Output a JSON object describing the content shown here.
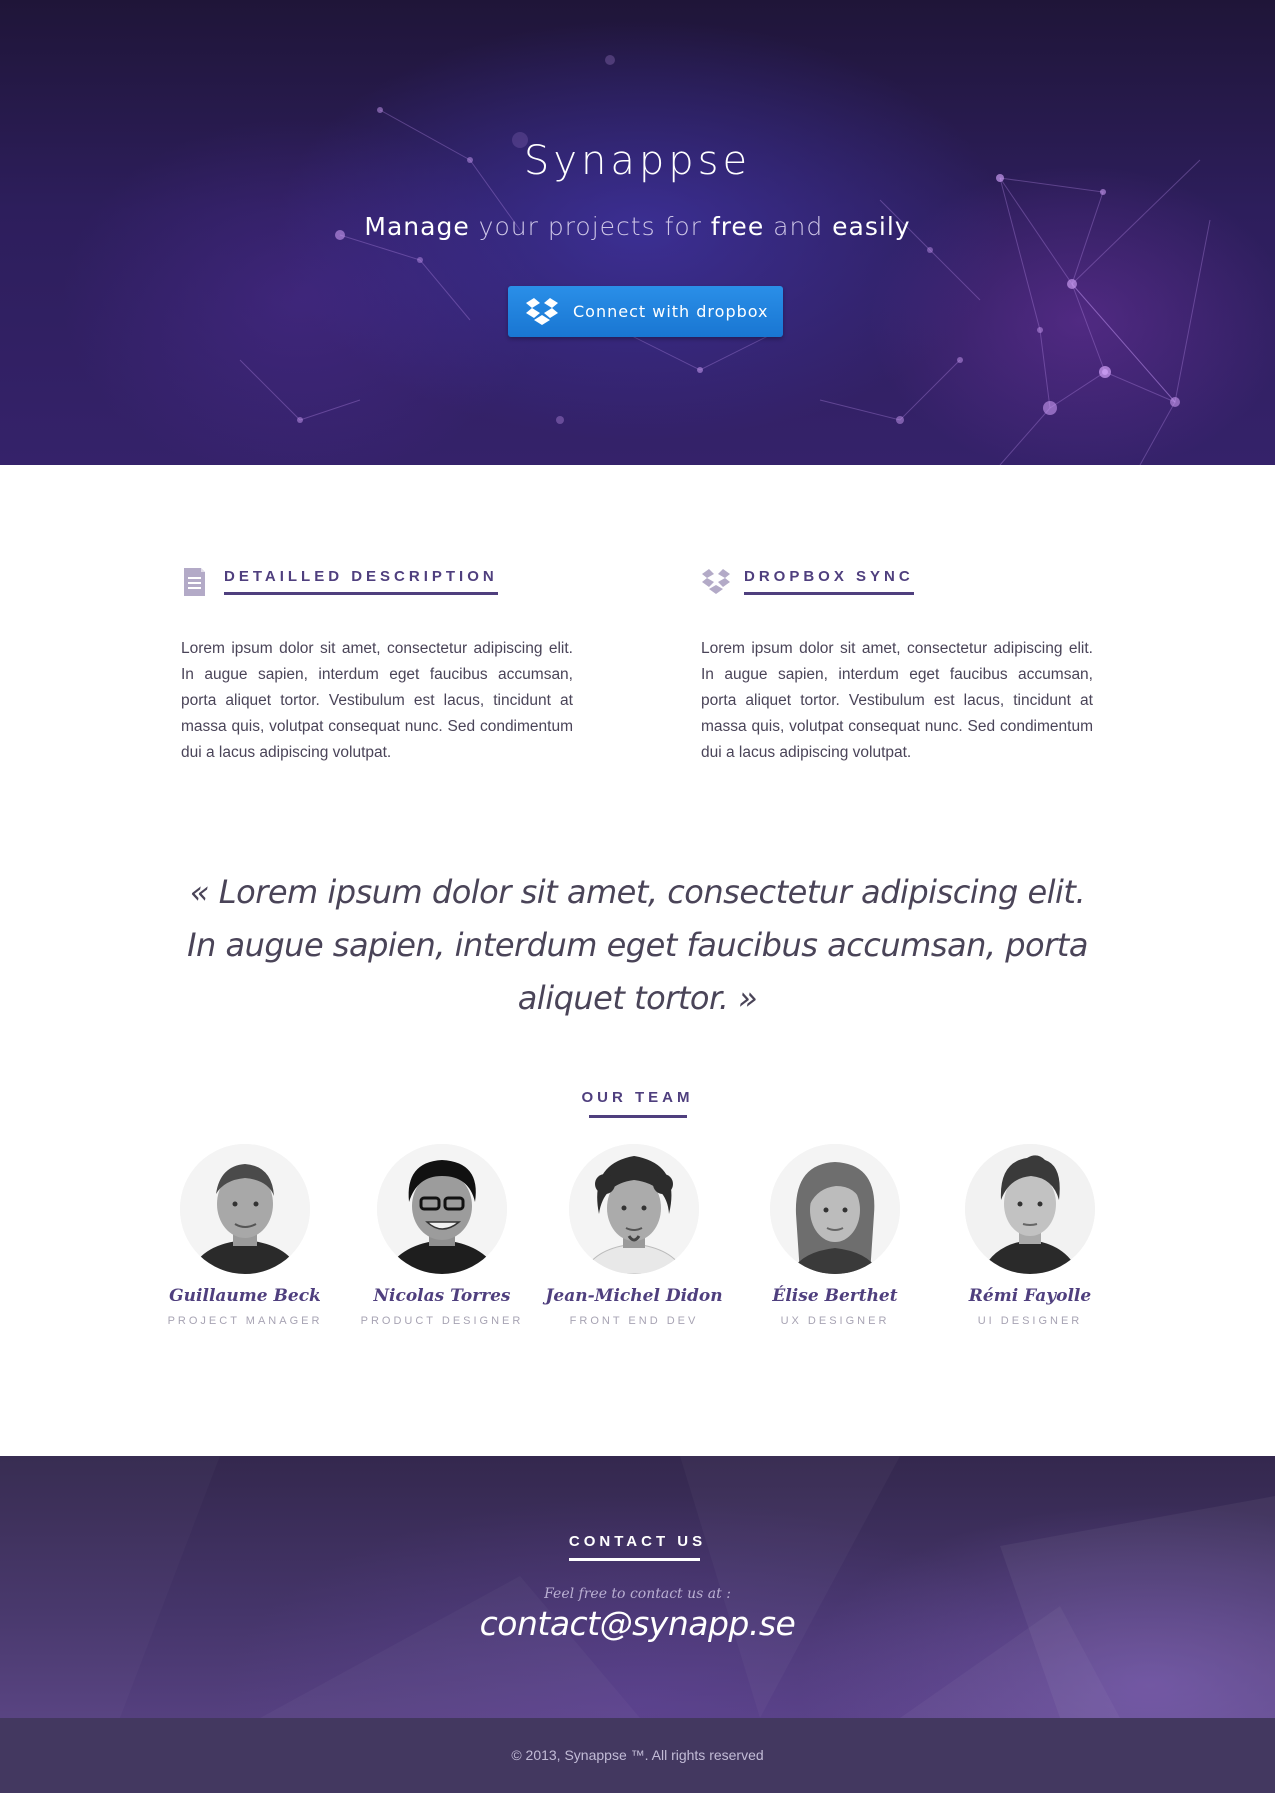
{
  "colors": {
    "brand_purple": "#4f3f7e",
    "dropbox_blue": "#1f86e0",
    "hero_dark": "#2d1e5c",
    "footer_bg": "#433860"
  },
  "hero": {
    "title": "Synappse",
    "subtitle": {
      "w1": "Manage",
      "w2": "your projects for",
      "w3": "free",
      "w4": "and",
      "w5": "easily"
    },
    "button": {
      "label": "Connect with dropbox",
      "icon": "dropbox-icon"
    }
  },
  "features": [
    {
      "icon": "document-icon",
      "title": "DETAILLED DESCRIPTION",
      "text": "Lorem ipsum dolor sit amet, consectetur adipiscing elit. In augue sapien, interdum eget faucibus accumsan, porta aliquet tortor. Vestibulum est lacus, tincidunt at massa quis, volutpat consequat nunc. Sed condimentum dui a lacus adipiscing volutpat."
    },
    {
      "icon": "dropbox-icon",
      "title": "DROPBOX SYNC",
      "text": "Lorem ipsum dolor sit amet, consectetur adipiscing elit. In augue sapien, interdum eget faucibus accumsan, porta aliquet tortor. Vestibulum est lacus, tincidunt at massa quis, volutpat consequat nunc. Sed condimentum dui a lacus adipiscing volutpat."
    }
  ],
  "quote": "« Lorem ipsum dolor sit amet, consectetur adipiscing elit. In augue sapien, interdum eget faucibus accumsan, porta aliquet tortor.  »",
  "team": {
    "title": "OUR TEAM",
    "members": [
      {
        "name": "Guillaume Beck",
        "role": "PROJECT MANAGER"
      },
      {
        "name": "Nicolas Torres",
        "role": "PRODUCT DESIGNER"
      },
      {
        "name": "Jean-Michel Didon",
        "role": "FRONT END DEV"
      },
      {
        "name": "Élise Berthet",
        "role": "UX DESIGNER"
      },
      {
        "name": "Rémi Fayolle",
        "role": "UI DESIGNER"
      }
    ]
  },
  "contact": {
    "title": "CONTACT US",
    "lead": "Feel free to contact us at :",
    "email": "contact@synapp.se"
  },
  "footer": {
    "text": "© 2013, Synappse ™.  All rights reserved"
  }
}
